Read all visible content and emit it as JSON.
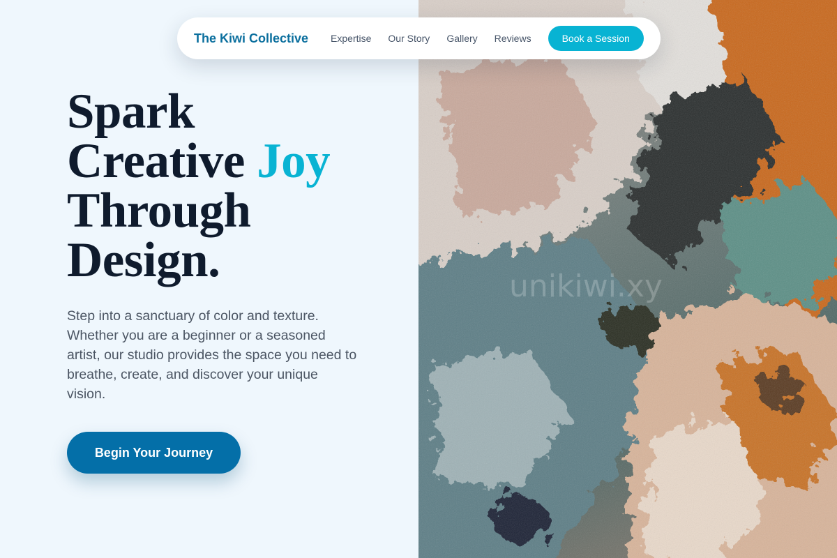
{
  "nav": {
    "brand": "The Kiwi Collective",
    "links": [
      "Expertise",
      "Our Story",
      "Gallery",
      "Reviews"
    ],
    "cta": "Book a Session"
  },
  "hero": {
    "title_line1": "Spark",
    "title_line2_a": "Creative ",
    "title_line2_accent": "Joy",
    "title_line3": "Through",
    "title_line4": "Design.",
    "body": "Step into a sanctuary of color and texture. Whether you are a beginner or a seasoned artist, our studio provides the space you need to breathe, create, and discover your unique vision.",
    "cta": "Begin Your Journey"
  },
  "image": {
    "subject": "textured-oil-painting",
    "watermark": "unikiwi.xy"
  },
  "colors": {
    "brand": "#0b6f9e",
    "accent": "#08b3d3",
    "primary_button": "#046fa8",
    "background": "#eff7fd",
    "heading": "#0f1b2d"
  }
}
